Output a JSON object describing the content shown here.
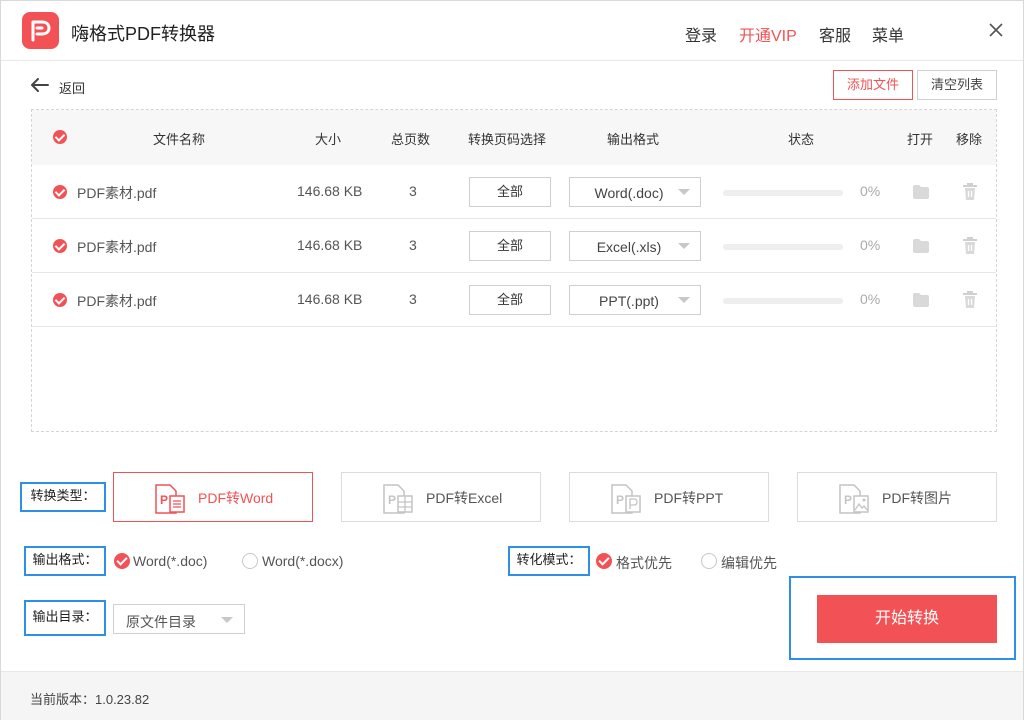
{
  "app": {
    "title": "嗨格式PDF转换器",
    "brand_color": "#f25255",
    "highlight_color": "#2f8fe6"
  },
  "titlebar": {
    "login": "登录",
    "vip": "开通VIP",
    "service": "客服",
    "menu": "菜单",
    "close_icon": "close-icon"
  },
  "toolbar": {
    "back": "返回",
    "add_file": "添加文件",
    "clear_list": "清空列表"
  },
  "table": {
    "headers": {
      "name": "文件名称",
      "size": "大小",
      "pages": "总页数",
      "page_select": "转换页码选择",
      "format": "输出格式",
      "status": "状态",
      "open": "打开",
      "remove": "移除"
    },
    "rows": [
      {
        "name": "PDF素材.pdf",
        "size": "146.68 KB",
        "pages": "3",
        "page_select": "全部",
        "format": "Word(.doc)",
        "progress": 0,
        "percent": "0%"
      },
      {
        "name": "PDF素材.pdf",
        "size": "146.68 KB",
        "pages": "3",
        "page_select": "全部",
        "format": "Excel(.xls)",
        "progress": 0,
        "percent": "0%"
      },
      {
        "name": "PDF素材.pdf",
        "size": "146.68 KB",
        "pages": "3",
        "page_select": "全部",
        "format": "PPT(.ppt)",
        "progress": 0,
        "percent": "0%"
      }
    ]
  },
  "conversion_type": {
    "label": "转换类型：",
    "options": [
      {
        "label": "PDF转Word",
        "icon": "pdf-word-icon",
        "active": true
      },
      {
        "label": "PDF转Excel",
        "icon": "pdf-excel-icon",
        "active": false
      },
      {
        "label": "PDF转PPT",
        "icon": "pdf-ppt-icon",
        "active": false
      },
      {
        "label": "PDF转图片",
        "icon": "pdf-image-icon",
        "active": false
      }
    ]
  },
  "output_format": {
    "label": "输出格式：",
    "options": [
      {
        "label": "Word(*.doc)",
        "selected": true
      },
      {
        "label": "Word(*.docx)",
        "selected": false
      }
    ]
  },
  "convert_mode": {
    "label": "转化模式：",
    "options": [
      {
        "label": "格式优先",
        "selected": true
      },
      {
        "label": "编辑优先",
        "selected": false
      }
    ]
  },
  "output_dir": {
    "label": "输出目录：",
    "value": "原文件目录"
  },
  "start": {
    "label": "开始转换"
  },
  "footer": {
    "version": "当前版本：1.0.23.82"
  }
}
